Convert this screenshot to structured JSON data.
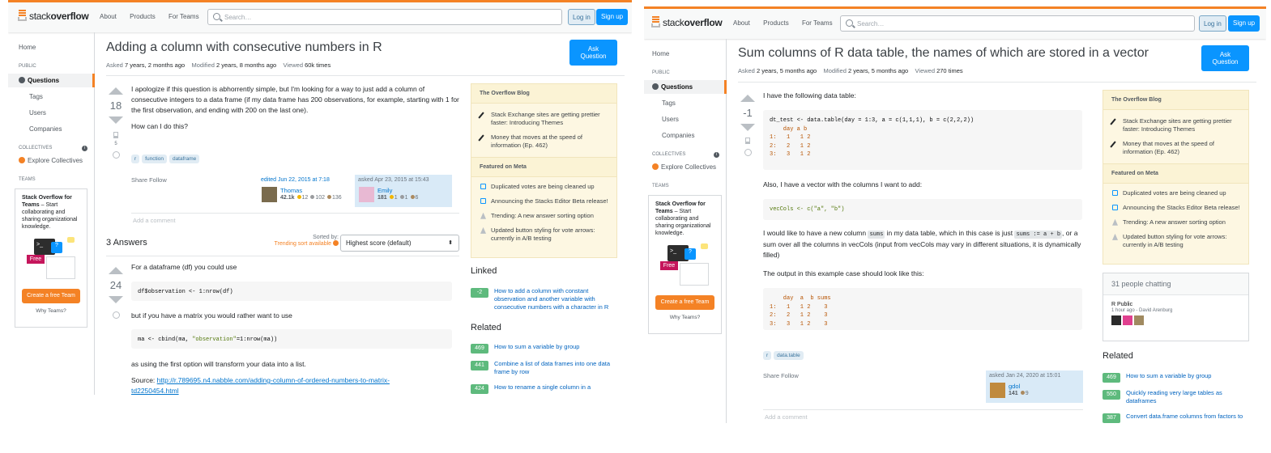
{
  "nav": {
    "logo_prefix": "stack",
    "logo_bold": "overflow",
    "about": "About",
    "products": "Products",
    "for_teams": "For Teams",
    "search_placeholder": "Search…",
    "login": "Log in",
    "signup": "Sign up"
  },
  "leftnav": {
    "home": "Home",
    "public": "PUBLIC",
    "questions": "Questions",
    "tags": "Tags",
    "users": "Users",
    "companies": "Companies",
    "collectives": "COLLECTIVES",
    "explore_collectives": "Explore Collectives",
    "teams": "TEAMS",
    "teams_title": "Stack Overflow for Teams",
    "teams_body": " – Start collaborating and sharing organizational knowledge.",
    "free_badge": "Free",
    "create_team": "Create a free Team",
    "why_teams": "Why Teams?"
  },
  "sidebar": {
    "blog_header": "The Overflow Blog",
    "blog_items": [
      "Stack Exchange sites are getting prettier faster: Introducing Themes",
      "Money that moves at the speed of information (Ep. 462)"
    ],
    "meta_header": "Featured on Meta",
    "meta_items": [
      "Duplicated votes are being cleaned up",
      "Announcing the Stacks Editor Beta release!",
      "Trending: A new answer sorting option",
      "Updated button styling for vote arrows: currently in A/B testing"
    ]
  },
  "left_page": {
    "title": "Adding a column with consecutive numbers in R",
    "asked_label": "Asked",
    "asked_value": "7 years, 2 months ago",
    "modified_label": "Modified",
    "modified_value": "2 years, 8 months ago",
    "viewed_label": "Viewed",
    "viewed_value": "60k times",
    "ask_button": "Ask Question",
    "question": {
      "votes": "18",
      "bookmarks": "5",
      "p1": "I apologize if this question is abhorrently simple, but I'm looking for a way to just add a column of consecutive integers to a data frame (if my data frame has 200 observations, for example, starting with 1 for the first observation, and ending with 200 on the last one).",
      "p2": "How can I do this?",
      "tags": [
        "r",
        "function",
        "dataframe"
      ],
      "share_follow": "Share  Follow",
      "edited": "edited Jun 22, 2015 at 7:18",
      "editor_name": "Thomas",
      "editor_rep": "42.1k",
      "editor_gold": "12",
      "editor_silver": "102",
      "editor_bronze": "136",
      "asked_card": "asked Apr 23, 2015 at 15:43",
      "asker_name": "Emily",
      "asker_rep": "181",
      "asker_gold": "1",
      "asker_silver": "1",
      "asker_bronze": "6",
      "add_comment": "Add a comment"
    },
    "answers_count": "3 Answers",
    "sorted_by": "Sorted by:",
    "trending_sort": "Trending sort available",
    "sort_value": "Highest score (default)",
    "answer": {
      "votes": "24",
      "p1": "For a dataframe (df) you could use",
      "code1": "df$observation <- 1:nrow(df)",
      "p2": "but if you have a matrix you would rather want to use",
      "code2_a": "ma <- cbind(ma, ",
      "code2_s": "\"observation\"",
      "code2_b": "=1:nrow(ma))",
      "p3": "as using the first option will transform your data into a list.",
      "source_label": "Source: ",
      "source_link": "http://r.789695.n4.nabble.com/adding-column-of-ordered-numbers-to-matrix-td2250454.html"
    },
    "linked_header": "Linked",
    "linked": [
      {
        "score": "-2",
        "text": "How to add a column with constant observation and another variable with consecutive numbers with a character in R"
      }
    ],
    "related_header": "Related",
    "related": [
      {
        "score": "469",
        "text": "How to sum a variable by group"
      },
      {
        "score": "441",
        "text": "Combine a list of data frames into one data frame by row"
      },
      {
        "score": "424",
        "text": "How to rename a single column in a"
      }
    ]
  },
  "right_page": {
    "title": "Sum columns of R data table, the names of which are stored in a vector",
    "asked_label": "Asked",
    "asked_value": "2 years, 5 months ago",
    "modified_label": "Modified",
    "modified_value": "2 years, 5 months ago",
    "viewed_label": "Viewed",
    "viewed_value": "270 times",
    "ask_button": "Ask Question",
    "votes": "-1",
    "p1": "I have the following data table:",
    "code1_l1": "dt_test <- data.table(day = 1:3, a = c(1,1,1), b = c(2,2,2))",
    "code1_out": "    day a b\n1:   1   1 2\n2:   2   1 2\n3:   3   1 2",
    "p2": "Also, I have a vector with the columns I want to add:",
    "code2": "vecCols <- c(\"a\", \"b\")",
    "p3a": "I would like to have a new column ",
    "p3_ic1": "sums",
    "p3b": " in my data table, which in this case is just ",
    "p3_ic2": "sums := a + b",
    "p3c": ", or a sum over all the columns in vecCols (input from vecCols may vary in different situations, it is dynamically filled)",
    "p4": "The output in this example case should look like this:",
    "code3": "    day  a  b sums\n1:   1   1 2    3\n2:   2   1 2    3\n3:   3   1 2    3",
    "tags": [
      "r",
      "data.table"
    ],
    "share_follow": "Share  Follow",
    "asked_card": "asked Jan 24, 2020 at 15:01",
    "asker_name": "gdol",
    "asker_rep": "141",
    "asker_bronze": "9",
    "add_comment": "Add a comment",
    "chat_header": "31 people chatting",
    "chat_room": "R Public",
    "chat_meta": "1 hour ago - David Arenburg",
    "related_header": "Related",
    "related": [
      {
        "score": "469",
        "text": "How to sum a variable by group"
      },
      {
        "score": "550",
        "text": "Quickly reading very large tables as dataframes"
      },
      {
        "score": "387",
        "text": "Convert data.frame columns from factors to"
      }
    ]
  },
  "colors": {
    "accent": "#f48225",
    "primary": "#0a95ff",
    "link": "#0074cc",
    "score_green": "#5eba7d",
    "blog_bg": "#fdf7e2"
  }
}
